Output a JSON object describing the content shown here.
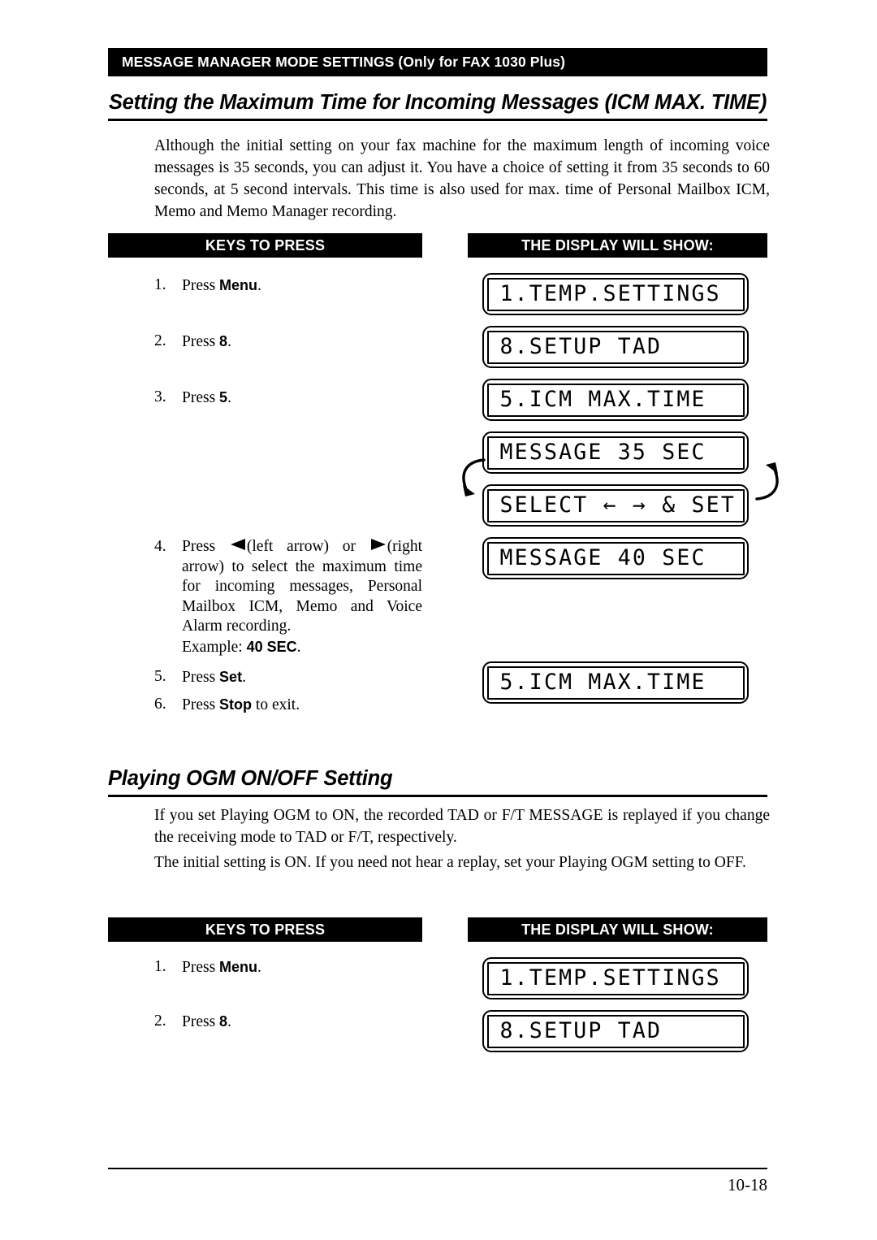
{
  "running_head": "MESSAGE MANAGER MODE SETTINGS (Only for FAX 1030 Plus)",
  "sections": {
    "icm": {
      "heading": "Setting the Maximum Time for Incoming Messages (ICM MAX. TIME)",
      "intro": "Although the initial setting on your fax machine for the maximum length of incoming voice messages is 35 seconds, you can adjust it. You have a choice of setting it from 35 seconds to 60 seconds, at 5 second intervals. This time is also used for max. time of Personal Mailbox ICM, Memo and Memo Manager recording.",
      "column_headers": {
        "keys": "KEYS TO PRESS",
        "display": "THE DISPLAY WILL SHOW:"
      },
      "steps": [
        {
          "num": "1.",
          "pre": "Press ",
          "key": "Menu",
          "post": "."
        },
        {
          "num": "2.",
          "pre": "Press ",
          "key": "8",
          "post": "."
        },
        {
          "num": "3.",
          "pre": "Press ",
          "key": "5",
          "post": "."
        },
        {
          "num": "4.",
          "pre": "Press ",
          "left_arrow_label": "(left arrow)",
          "conj": " or ",
          "right_arrow_label": "(right arrow)",
          "body": " to select the maximum time for incoming messages, Personal Mailbox ICM, Memo and Voice Alarm recording.",
          "example_label": "Example: ",
          "example_value": "40 SEC",
          "example_post": "."
        },
        {
          "num": "5.",
          "pre": "Press ",
          "key": "Set",
          "post": "."
        },
        {
          "num": "6.",
          "pre": "Press ",
          "key": "Stop",
          "post": " to exit."
        }
      ],
      "displays": [
        "1.TEMP.SETTINGS",
        "8.SETUP TAD",
        "5.ICM MAX.TIME",
        "MESSAGE 35 SEC",
        "SELECT ← → & SET",
        "MESSAGE 40 SEC",
        "5.ICM MAX.TIME"
      ],
      "cycle_arrows": {
        "left": "curved-arrow-down-left-icon",
        "right": "curved-arrow-up-right-icon"
      }
    },
    "ogm": {
      "heading": "Playing OGM ON/OFF Setting",
      "para1": "If you set Playing OGM to ON, the recorded TAD or F/T MESSAGE is replayed if you change the receiving mode to TAD or F/T, respectively.",
      "para2": "The initial setting is ON.  If you need not hear a replay, set your Playing OGM setting to OFF.",
      "column_headers": {
        "keys": "KEYS TO PRESS",
        "display": "THE DISPLAY WILL SHOW:"
      },
      "steps": [
        {
          "num": "1.",
          "pre": "Press ",
          "key": "Menu",
          "post": "."
        },
        {
          "num": "2.",
          "pre": "Press ",
          "key": "8",
          "post": "."
        }
      ],
      "displays": [
        "1.TEMP.SETTINGS",
        "8.SETUP TAD"
      ]
    }
  },
  "footer": {
    "page_number": "10-18"
  },
  "colors": {
    "bar_background": "#000000",
    "bar_text": "#ffffff",
    "page_background": "#ffffff",
    "body_text": "#000000"
  }
}
